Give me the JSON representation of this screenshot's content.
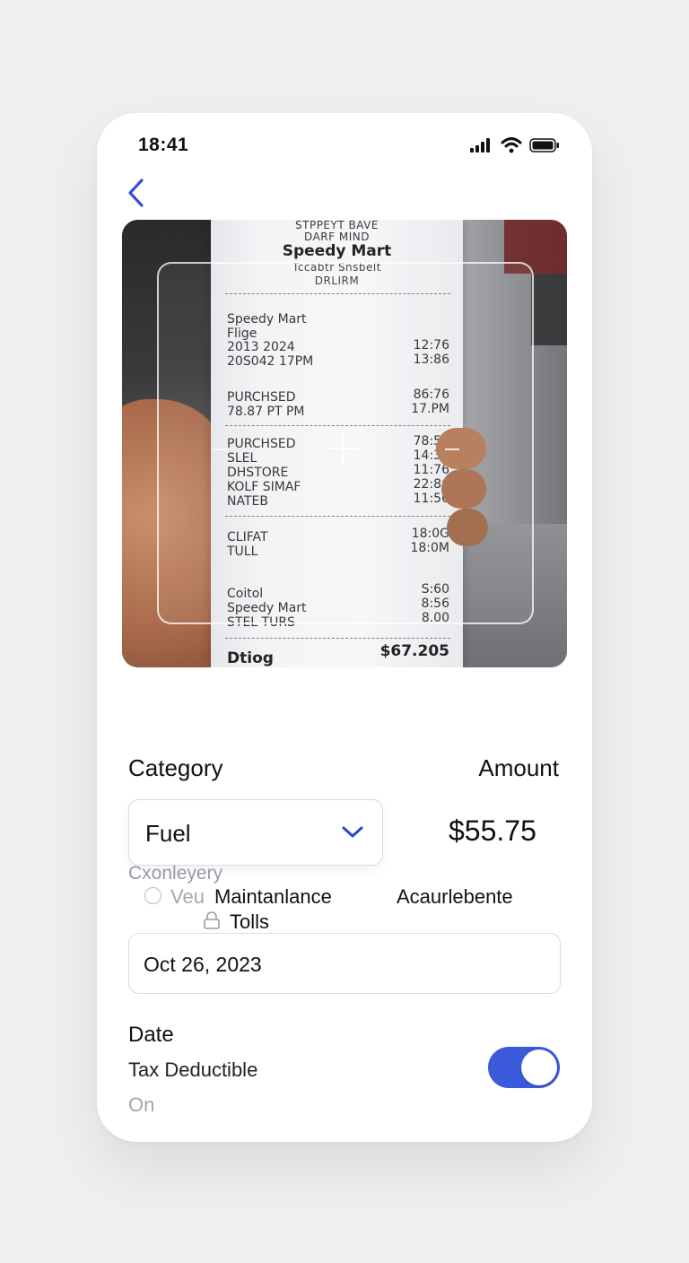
{
  "status_bar": {
    "time": "18:41",
    "icons": [
      "signal-icon",
      "wifi-icon",
      "battery-icon"
    ]
  },
  "navigation": {
    "back_icon": "chevron-left-icon",
    "accent_color": "#3b4fd8"
  },
  "receipt": {
    "header_line_1": "STPPEYT BAVE",
    "header_line_2": "DARF MIND",
    "store_name": "Speedy Mart",
    "header_line_4": "Tccabtr Snsbelt",
    "header_line_5": "DRLIRM",
    "block_1": [
      {
        "left": "Speedy Mart",
        "right": ""
      },
      {
        "left": "Flige",
        "right": ""
      },
      {
        "left": "2013 2024",
        "right": "12:76"
      },
      {
        "left": "20S042 17PM",
        "right": "13:86"
      }
    ],
    "block_2": [
      {
        "left": "PURCHSED",
        "right": "86:76"
      },
      {
        "left": "78.87 PT PM",
        "right": "17.PM"
      }
    ],
    "block_3": [
      {
        "left": "PURCHSED",
        "right": "78:50"
      },
      {
        "left": "SLEL",
        "right": "14:30"
      },
      {
        "left": "DHSTORE",
        "right": "11:76"
      },
      {
        "left": "KOLF SIMAF",
        "right": "22:86"
      },
      {
        "left": "NATEB",
        "right": "11:50"
      }
    ],
    "block_4": [
      {
        "left": "CLIFAT",
        "right": "18:0G"
      },
      {
        "left": "TULL",
        "right": "18:0M"
      }
    ],
    "block_5": [
      {
        "left": "Coitol",
        "right": "S:60"
      },
      {
        "left": "Speedy Mart",
        "right": "8:56"
      },
      {
        "left": "STEL TURS",
        "right": "8.00"
      }
    ],
    "footer_label": "Dtiog",
    "footer_total": "$67.205"
  },
  "form": {
    "category_label": "Category",
    "amount_label": "Amount",
    "category_selected": "Fuel",
    "amount_value": "$55.75",
    "dropdown_heading": "Cxonleyery",
    "options": {
      "faded": "Veu",
      "maintenance": "Maintanlance",
      "accessory": "Acaurlebente",
      "tolls": "Tolls"
    },
    "date_value": "Oct 26, 2023",
    "date_label": "Date",
    "tax_label": "Tax Deductible",
    "tax_state": "On",
    "tax_enabled": true,
    "toggle_color": "#3b5bdb"
  }
}
